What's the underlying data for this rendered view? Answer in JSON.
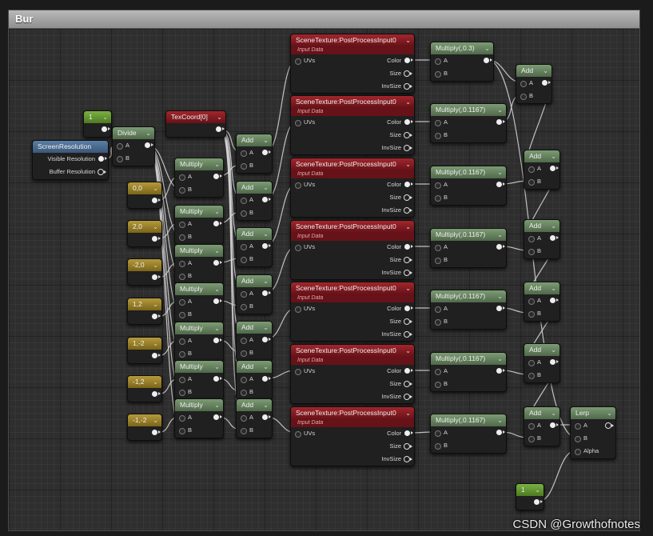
{
  "window": {
    "title": "Bur"
  },
  "nodes": {
    "const_one": {
      "title": "1"
    },
    "screen_res": {
      "title": "ScreenResolution",
      "out1": "Visible Resolution",
      "out2": "Buffer Resolution"
    },
    "divide": {
      "title": "Divide",
      "a": "A",
      "b": "B"
    },
    "texcoord": {
      "title": "TexCoord[0]"
    },
    "vec_00": {
      "title": "0,0"
    },
    "vec_20": {
      "title": "2,0"
    },
    "vec_m20": {
      "title": "-2,0"
    },
    "vec_12": {
      "title": "1,2"
    },
    "vec_1m2": {
      "title": "1,-2"
    },
    "vec_m12": {
      "title": "-1,2"
    },
    "vec_m1m2": {
      "title": "-1,-2"
    },
    "mul_label": "Multiply",
    "add_label": "Add",
    "pin_a": "A",
    "pin_b": "B",
    "scene_title": "SceneTexture:PostProcessInput0",
    "scene_sub": "Input Data",
    "scene_uvs": "UVs",
    "scene_color": "Color",
    "scene_size": "Size",
    "scene_invsize": "InvSize",
    "mulw_first": "Multiply(,0.3)",
    "mulw_rest": "Multiply(,0.1167)",
    "lerp": {
      "title": "Lerp",
      "a": "A",
      "b": "B",
      "alpha": "Alpha"
    },
    "const_one_b": {
      "title": "1"
    }
  },
  "watermark": "CSDN @Growthofnotes",
  "colors": {
    "accent_green": "#50694a",
    "scene_red": "#a2262c",
    "vector_gold": "#7a6418",
    "scalar_lime": "#4d7a22",
    "resolution_blue": "#3a5778"
  }
}
